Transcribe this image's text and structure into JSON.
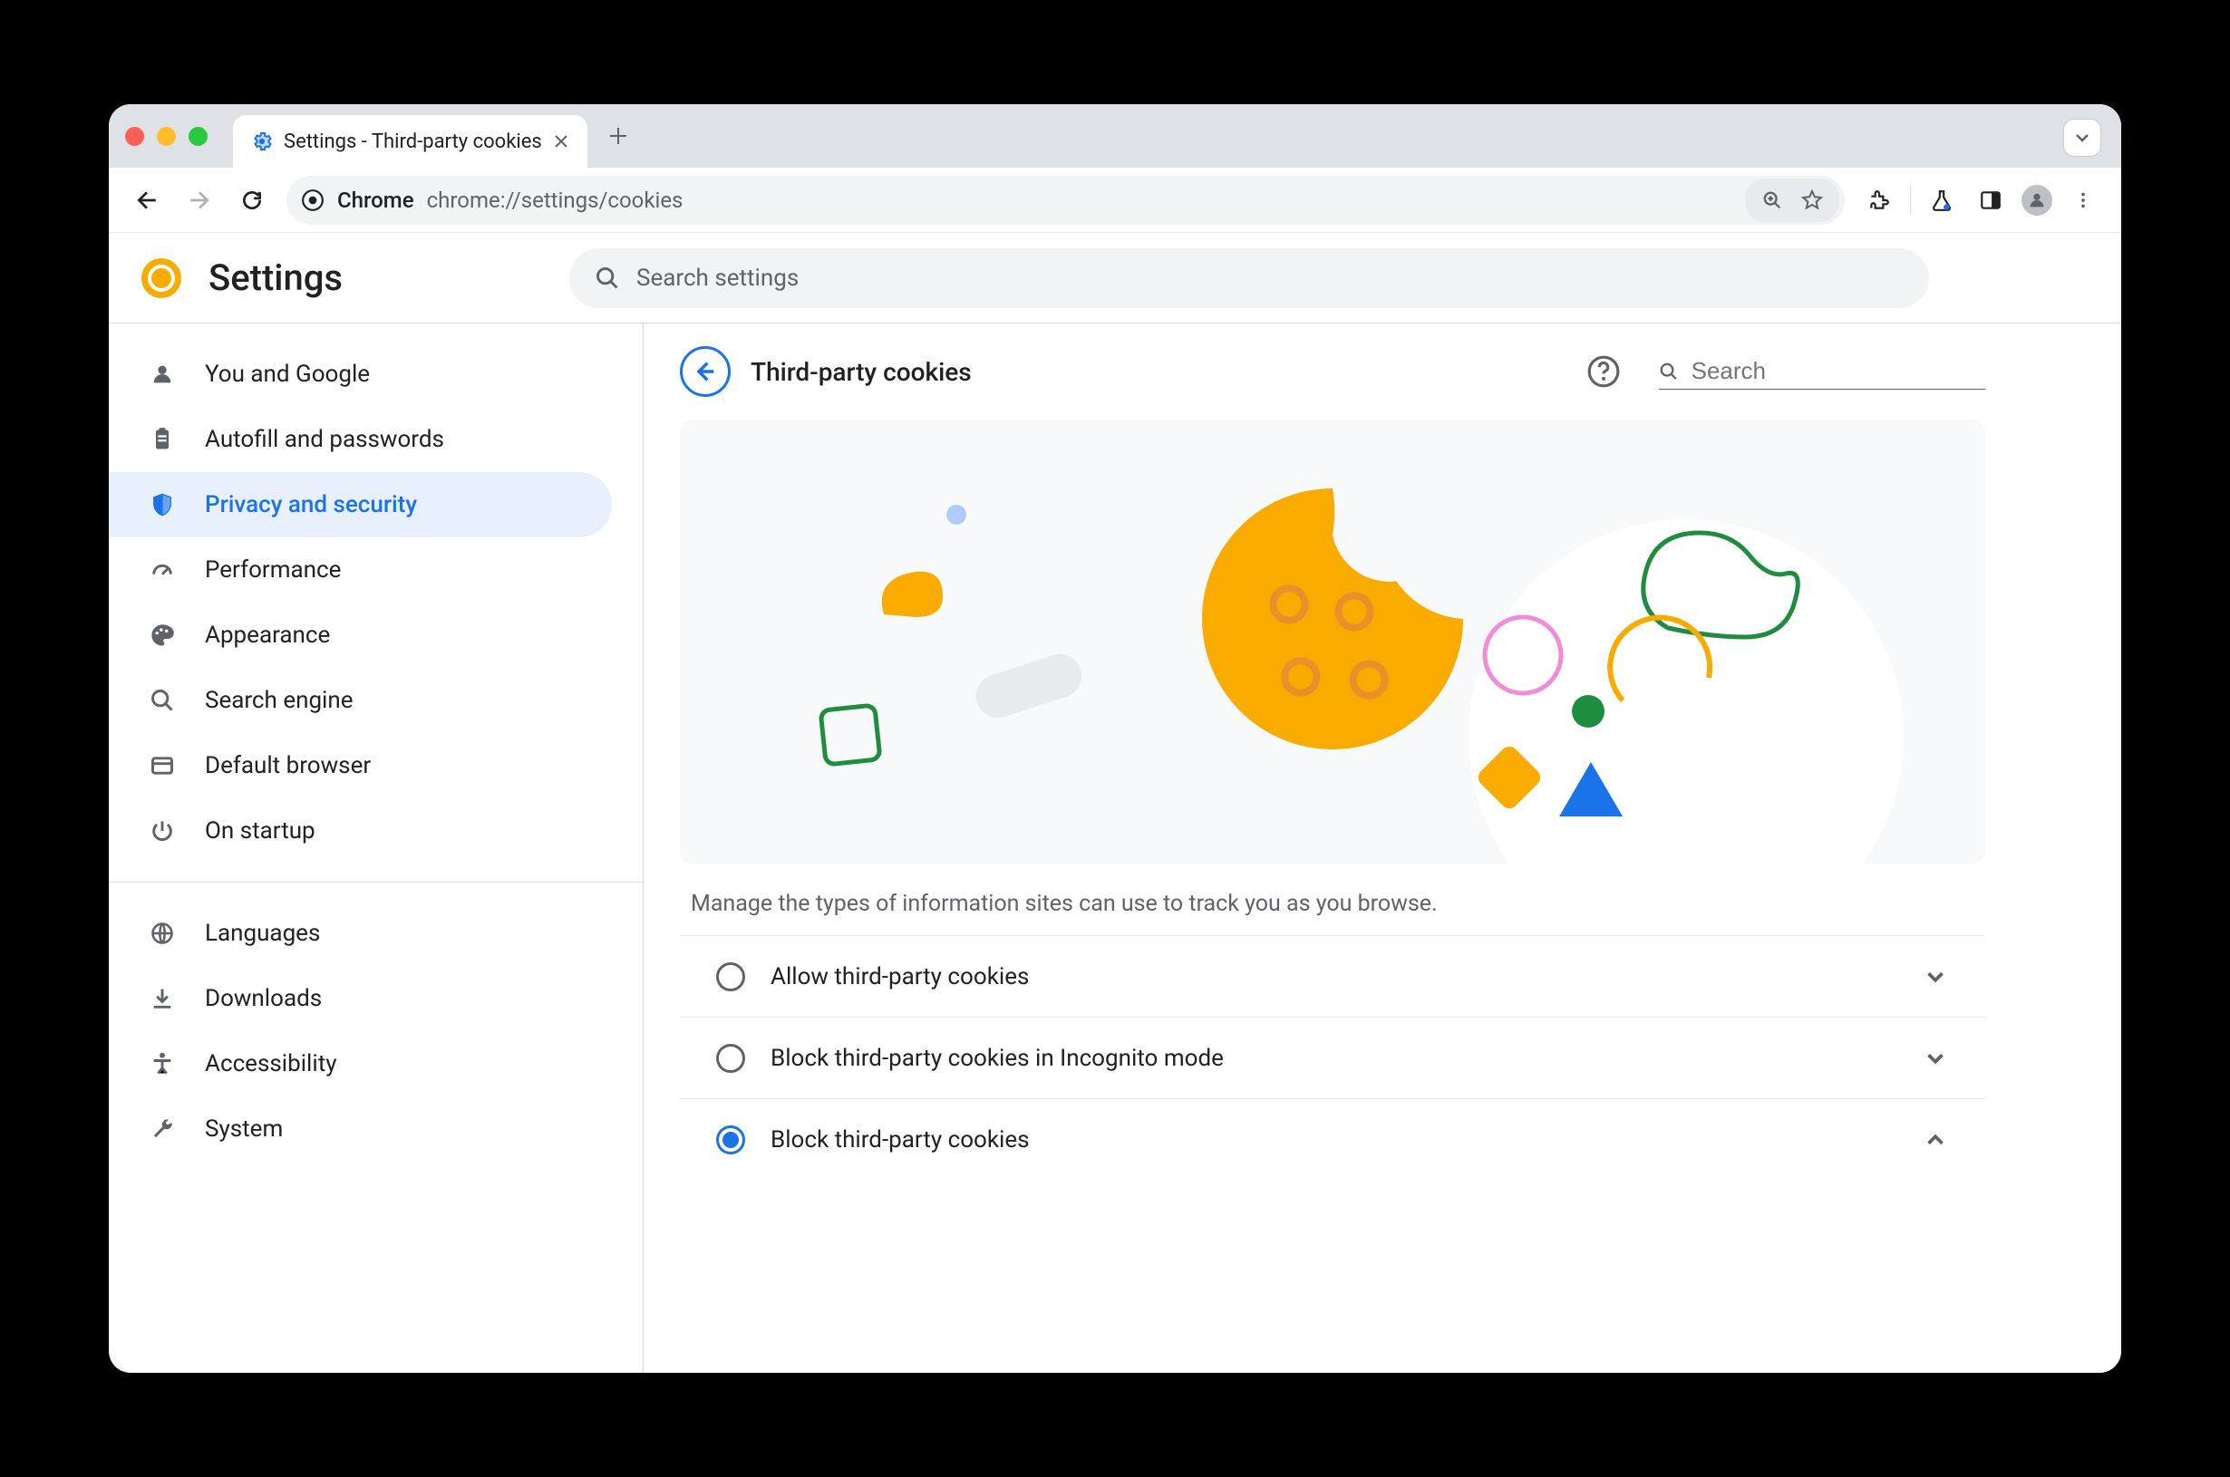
{
  "browser": {
    "tab_title": "Settings - Third-party cookies",
    "omnibox_chip": "Chrome",
    "omnibox_url": "chrome://settings/cookies"
  },
  "header": {
    "app_title": "Settings",
    "search_placeholder": "Search settings"
  },
  "sidebar": {
    "items": [
      {
        "icon": "person",
        "label": "You and Google"
      },
      {
        "icon": "clipboard",
        "label": "Autofill and passwords"
      },
      {
        "icon": "shield",
        "label": "Privacy and security",
        "active": true
      },
      {
        "icon": "speedometer",
        "label": "Performance"
      },
      {
        "icon": "palette",
        "label": "Appearance"
      },
      {
        "icon": "search",
        "label": "Search engine"
      },
      {
        "icon": "browser",
        "label": "Default browser"
      },
      {
        "icon": "power",
        "label": "On startup"
      }
    ],
    "items2": [
      {
        "icon": "globe",
        "label": "Languages"
      },
      {
        "icon": "download",
        "label": "Downloads"
      },
      {
        "icon": "accessibility",
        "label": "Accessibility"
      },
      {
        "icon": "wrench",
        "label": "System"
      }
    ]
  },
  "page": {
    "title": "Third-party cookies",
    "search_placeholder": "Search",
    "description": "Manage the types of information sites can use to track you as you browse.",
    "options": [
      {
        "label": "Allow third-party cookies",
        "checked": false,
        "expanded": false
      },
      {
        "label": "Block third-party cookies in Incognito mode",
        "checked": false,
        "expanded": false
      },
      {
        "label": "Block third-party cookies",
        "checked": true,
        "expanded": true
      }
    ]
  }
}
